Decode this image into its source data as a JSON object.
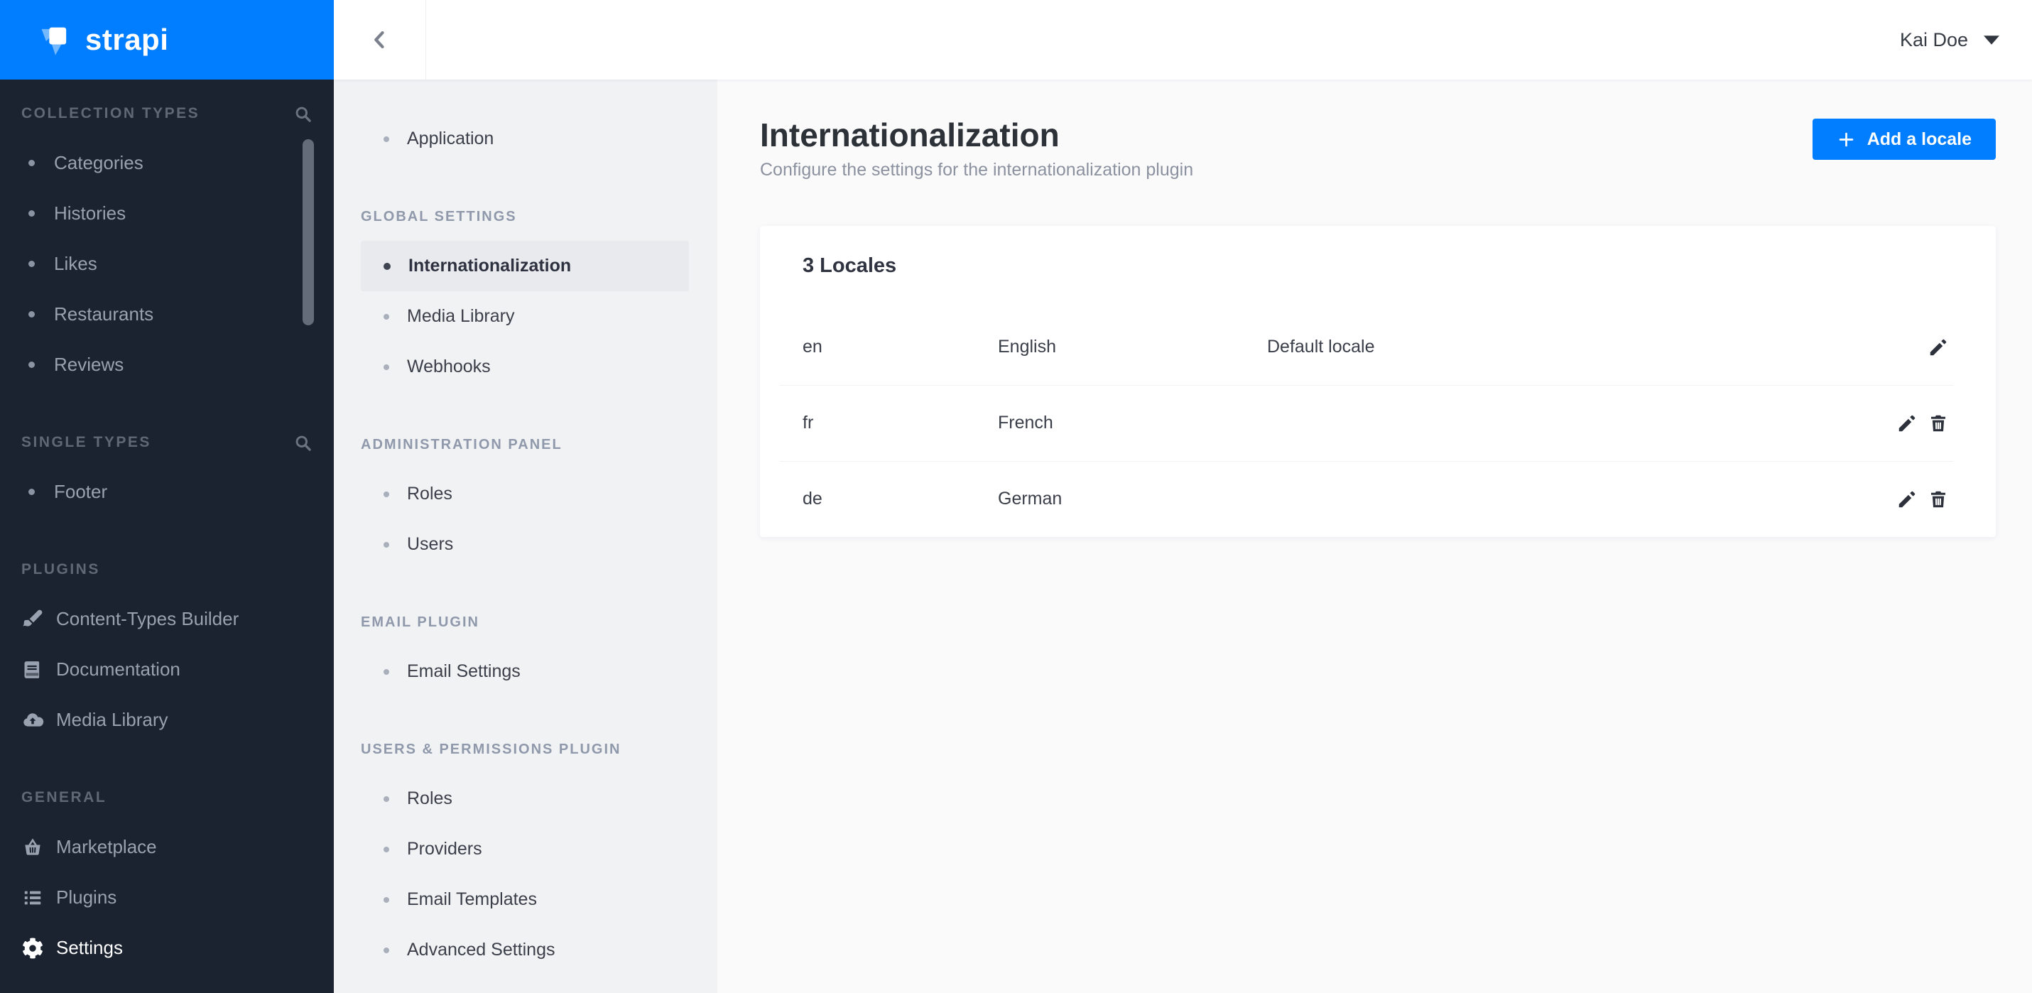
{
  "colors": {
    "accent": "#007eff",
    "sidebar_bg": "#1b2230",
    "panel_bg": "#f1f2f4",
    "content_bg": "#fafafb"
  },
  "brand": {
    "name": "strapi"
  },
  "topbar": {
    "user_name": "Kai Doe"
  },
  "left_sidebar": {
    "sections": [
      {
        "label": "COLLECTION TYPES",
        "search_icon": "search-icon",
        "items": [
          {
            "label": "Categories",
            "icon": "bullet"
          },
          {
            "label": "Histories",
            "icon": "bullet"
          },
          {
            "label": "Likes",
            "icon": "bullet"
          },
          {
            "label": "Restaurants",
            "icon": "bullet"
          },
          {
            "label": "Reviews",
            "icon": "bullet"
          }
        ]
      },
      {
        "label": "SINGLE TYPES",
        "search_icon": "search-icon",
        "items": [
          {
            "label": "Footer",
            "icon": "bullet"
          }
        ]
      },
      {
        "label": "PLUGINS",
        "items": [
          {
            "label": "Content-Types Builder",
            "icon": "paint-brush-icon"
          },
          {
            "label": "Documentation",
            "icon": "book-icon"
          },
          {
            "label": "Media Library",
            "icon": "cloud-upload-icon"
          }
        ]
      },
      {
        "label": "GENERAL",
        "items": [
          {
            "label": "Marketplace",
            "icon": "basket-icon"
          },
          {
            "label": "Plugins",
            "icon": "list-icon"
          },
          {
            "label": "Settings",
            "icon": "gear-icon",
            "active": true
          }
        ]
      }
    ]
  },
  "settings_nav": {
    "top_items": [
      {
        "label": "Application"
      }
    ],
    "sections": [
      {
        "label": "GLOBAL SETTINGS",
        "items": [
          {
            "label": "Internationalization",
            "active": true
          },
          {
            "label": "Media Library"
          },
          {
            "label": "Webhooks"
          }
        ]
      },
      {
        "label": "ADMINISTRATION PANEL",
        "items": [
          {
            "label": "Roles"
          },
          {
            "label": "Users"
          }
        ]
      },
      {
        "label": "EMAIL PLUGIN",
        "items": [
          {
            "label": "Email Settings"
          }
        ]
      },
      {
        "label": "USERS & PERMISSIONS PLUGIN",
        "items": [
          {
            "label": "Roles"
          },
          {
            "label": "Providers"
          },
          {
            "label": "Email Templates"
          },
          {
            "label": "Advanced Settings"
          }
        ]
      }
    ]
  },
  "page": {
    "title": "Internationalization",
    "subtitle": "Configure the settings for the internationalization plugin",
    "add_locale_button": "Add a locale"
  },
  "locales_panel": {
    "heading": "3 Locales",
    "rows": [
      {
        "code": "en",
        "name": "English",
        "note": "Default locale"
      },
      {
        "code": "fr",
        "name": "French",
        "note": ""
      },
      {
        "code": "de",
        "name": "German",
        "note": ""
      }
    ]
  }
}
